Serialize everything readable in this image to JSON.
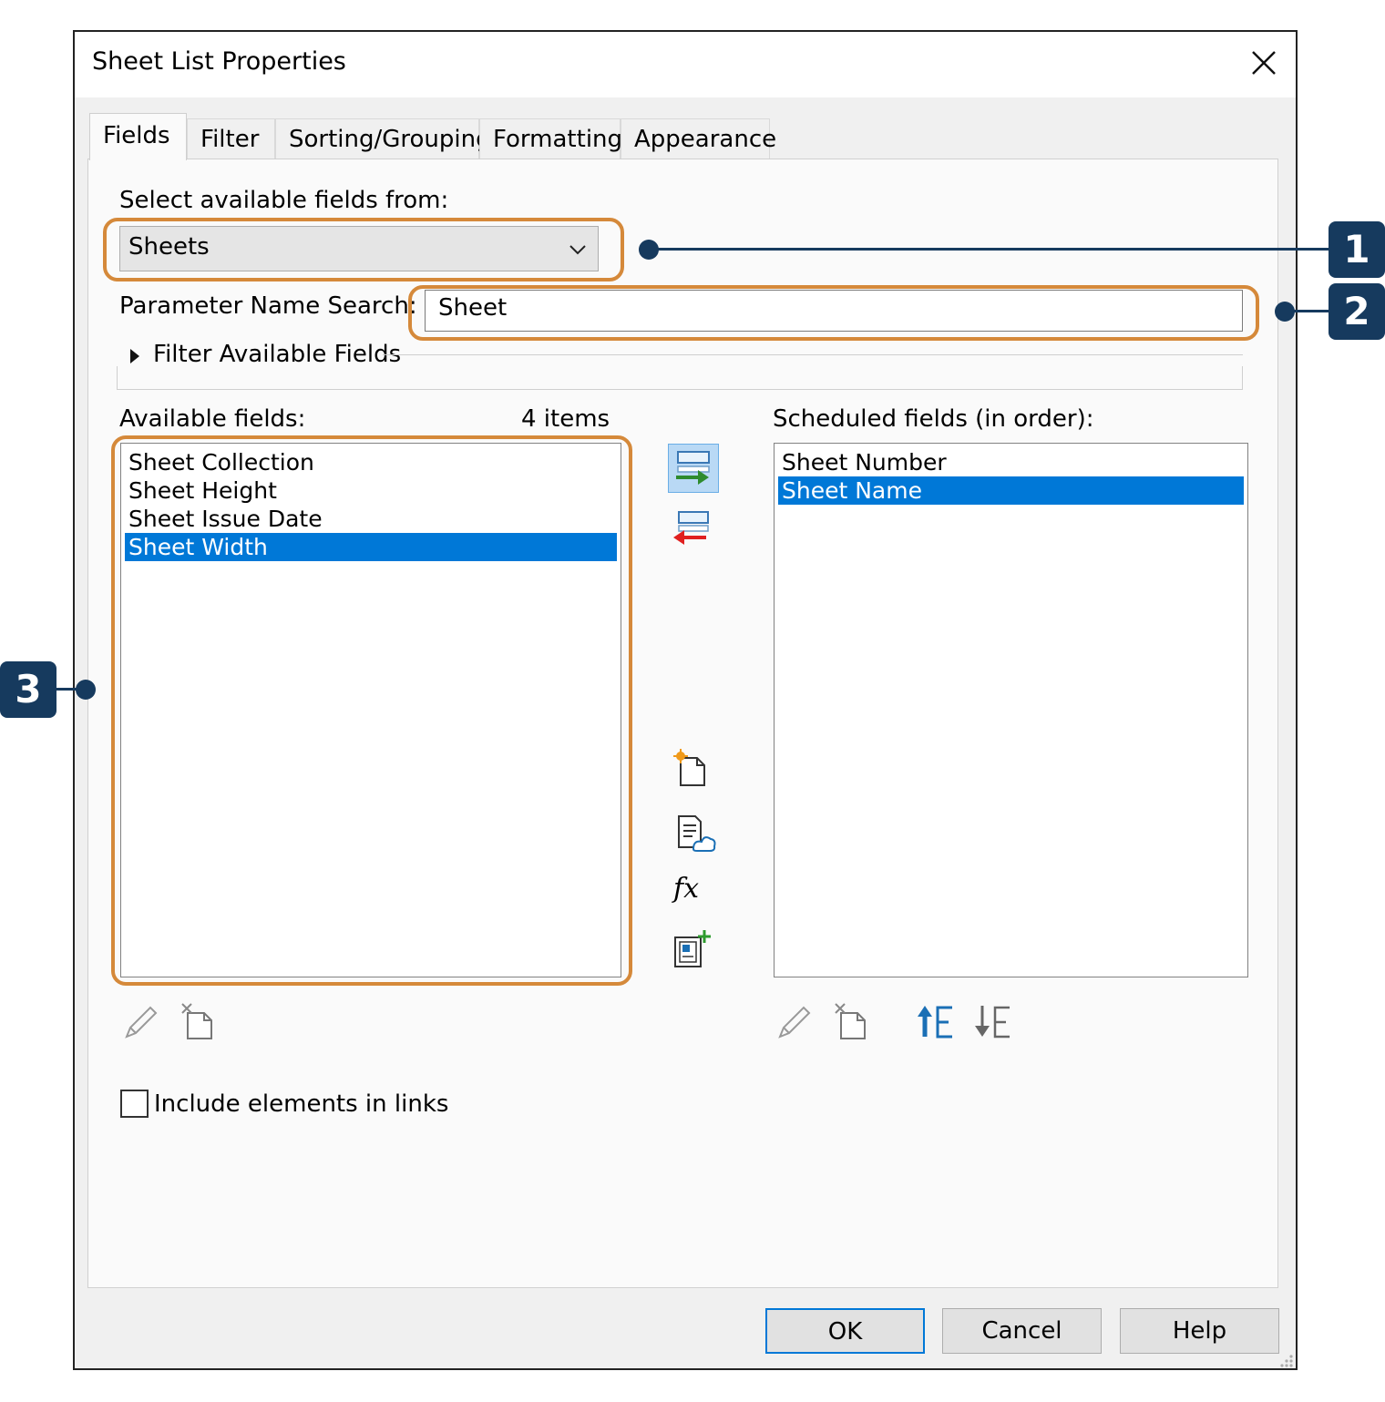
{
  "window": {
    "title": "Sheet List Properties"
  },
  "tabs": [
    {
      "label": "Fields"
    },
    {
      "label": "Filter"
    },
    {
      "label": "Sorting/Grouping"
    },
    {
      "label": "Formatting"
    },
    {
      "label": "Appearance"
    }
  ],
  "fields": {
    "select_from_label": "Select available fields from:",
    "select_from_value": "Sheets",
    "search_label": "Parameter Name Search:",
    "search_value": "Sheet",
    "filter_toggle_label": "Filter Available Fields",
    "available_label": "Available fields:",
    "available_count": "4 items",
    "available_items": [
      "Sheet Collection",
      "Sheet Height",
      "Sheet Issue Date",
      "Sheet Width"
    ],
    "scheduled_label": "Scheduled fields (in order):",
    "scheduled_items": [
      "Sheet Number",
      "Sheet Name"
    ],
    "include_links_label": "Include elements in links"
  },
  "buttons": {
    "ok": "OK",
    "cancel": "Cancel",
    "help": "Help"
  },
  "callouts": [
    "1",
    "2",
    "3"
  ],
  "colors": {
    "callout": "#163a5e",
    "highlight": "#d5893a",
    "selection": "#0078d7"
  }
}
